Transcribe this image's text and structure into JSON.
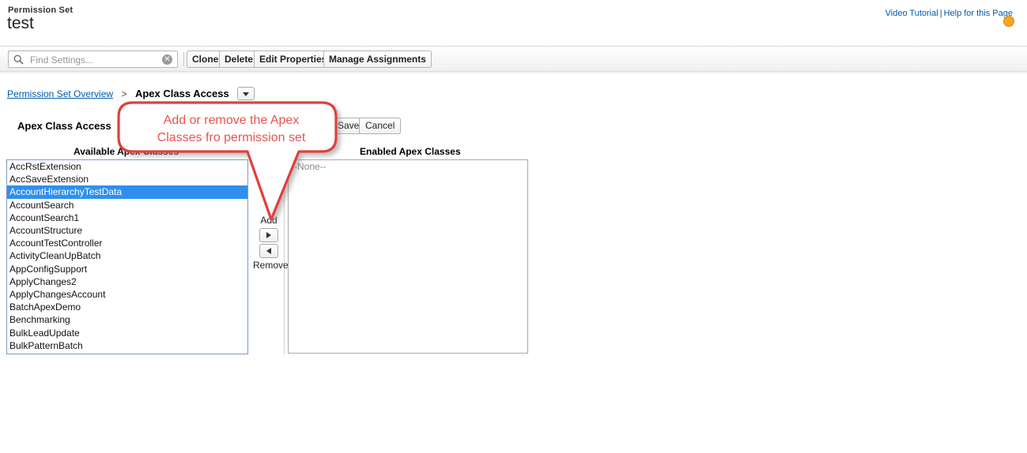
{
  "header": {
    "object_type": "Permission Set",
    "title": "test",
    "links": [
      {
        "label": "Video Tutorial"
      },
      {
        "label": "Help for this Page"
      }
    ],
    "separator": "|",
    "help_icon": "help-orb-icon"
  },
  "toolbar": {
    "search_placeholder": "Find Settings...",
    "search_value": "",
    "search_icon": "search-icon",
    "clear_icon": "clear-x-icon",
    "buttons": [
      {
        "label": "Clone"
      },
      {
        "label": "Delete"
      },
      {
        "label": "Edit Properties"
      },
      {
        "label": "Manage Assignments"
      }
    ]
  },
  "breadcrumb": {
    "parent": "Permission Set Overview",
    "separator": ">",
    "current": "Apex Class Access",
    "dropdown_icon": "chevron-down-icon"
  },
  "section": {
    "title": "Apex Class Access",
    "save_label": "Save",
    "cancel_label": "Cancel",
    "available_label": "Available Apex Classes",
    "enabled_label": "Enabled Apex Classes"
  },
  "transfer": {
    "add_label": "Add",
    "remove_label": "Remove",
    "add_icon": "arrow-right-icon",
    "remove_icon": "arrow-left-icon"
  },
  "available_classes": [
    "AccRstExtension",
    "AccSaveExtension",
    "AccountHierarchyTestData",
    "AccountSearch",
    "AccountSearch1",
    "AccountStructure",
    "AccountTestController",
    "ActivityCleanUpBatch",
    "AppConfigSupport",
    "ApplyChanges2",
    "ApplyChangesAccount",
    "BatchApexDemo",
    "Benchmarking",
    "BulkLeadUpdate",
    "BulkPatternBatch"
  ],
  "selected_available": "AccountHierarchyTestData",
  "enabled_classes": [
    "--None--"
  ],
  "callout": {
    "line1": "Add or remove the Apex",
    "line2": "Classes fro permission set",
    "color": "#e8544f"
  },
  "colors": {
    "link": "#015ba7",
    "selection": "#2f8fef",
    "callout": "#e8544f",
    "list_border_focus": "#7a9bc4",
    "list_border": "#a9a9a9"
  }
}
